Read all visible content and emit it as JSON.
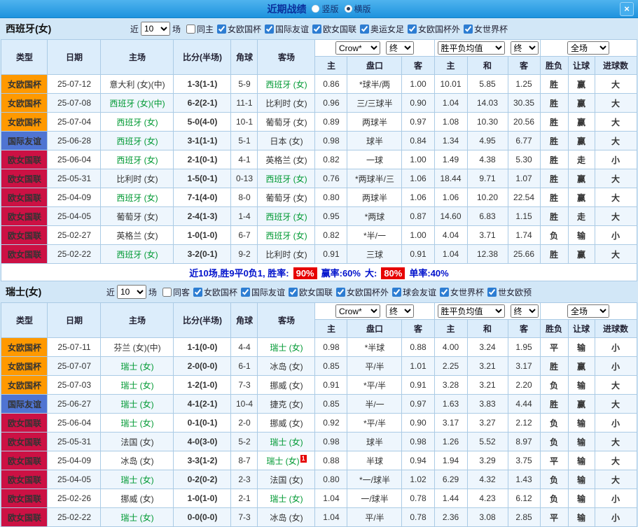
{
  "titlebar": {
    "title": "近期战绩",
    "radio_vertical": "竖版",
    "radio_horizontal": "横版",
    "close": "×"
  },
  "select_names": [
    "bookmaker-select",
    "handicap-final-select",
    "avg-type-select",
    "avg-final-select",
    "scope-select"
  ],
  "result_green": [
    "负",
    "输",
    "小"
  ],
  "colors": {
    "type_badge": {
      "女欧国杯": "#ff9900",
      "国际友谊": "#4f74d2",
      "欧女国联": "#cc1144"
    },
    "focus_team": "#009933",
    "opponent_team": "#993333",
    "score": "#dd2200",
    "odds": "#cc2200",
    "result_win": "#e60000",
    "result_lose": "#009900",
    "rate_chip_bg": "#e60000",
    "summary_text": "#0011cc"
  },
  "sections": [
    {
      "team_title": "西班牙(女)",
      "filter": {
        "near_label": "近",
        "near_value": "10",
        "games_label": "场",
        "checkboxes": [
          {
            "label": "同主",
            "checked": false
          },
          {
            "label": "女欧国杯",
            "checked": true
          },
          {
            "label": "国际友谊",
            "checked": true
          },
          {
            "label": "欧女国联",
            "checked": true
          },
          {
            "label": "奥运女足",
            "checked": true
          },
          {
            "label": "女欧国杯外",
            "checked": true
          },
          {
            "label": "女世界杯",
            "checked": true
          }
        ]
      },
      "dropdowns": [
        "Crow*",
        "终",
        "胜平负均值",
        "终",
        "全场"
      ],
      "columns": {
        "left": [
          "类型",
          "日期",
          "主场",
          "比分(半场)",
          "角球",
          "客场"
        ],
        "right": [
          "主",
          "盘口",
          "客",
          "主",
          "和",
          "客",
          "胜负",
          "让球",
          "进球数"
        ]
      },
      "rows": [
        {
          "type": "女欧国杯",
          "date": "25-07-12",
          "home": "意大利 (女)(中)",
          "home_focus": false,
          "score": "1-3(1-1)",
          "corner": "5-9",
          "away": "西班牙 (女)",
          "away_focus": true,
          "odds": [
            "0.86",
            "*球半/两",
            "1.00"
          ],
          "avg": [
            "10.01",
            "5.85",
            "1.25"
          ],
          "results": [
            "胜",
            "赢",
            "大"
          ]
        },
        {
          "type": "女欧国杯",
          "date": "25-07-08",
          "home": "西班牙 (女)(中)",
          "home_focus": true,
          "score": "6-2(2-1)",
          "corner": "11-1",
          "away": "比利时 (女)",
          "away_focus": false,
          "odds": [
            "0.96",
            "三/三球半",
            "0.90"
          ],
          "avg": [
            "1.04",
            "14.03",
            "30.35"
          ],
          "results": [
            "胜",
            "赢",
            "大"
          ]
        },
        {
          "type": "女欧国杯",
          "date": "25-07-04",
          "home": "西班牙 (女)",
          "home_focus": true,
          "score": "5-0(4-0)",
          "corner": "10-1",
          "away": "葡萄牙 (女)",
          "away_focus": false,
          "odds": [
            "0.89",
            "两球半",
            "0.97"
          ],
          "avg": [
            "1.08",
            "10.30",
            "20.56"
          ],
          "results": [
            "胜",
            "赢",
            "大"
          ]
        },
        {
          "type": "国际友谊",
          "date": "25-06-28",
          "home": "西班牙 (女)",
          "home_focus": true,
          "score": "3-1(1-1)",
          "corner": "5-1",
          "away": "日本 (女)",
          "away_focus": false,
          "odds": [
            "0.98",
            "球半",
            "0.84"
          ],
          "avg": [
            "1.34",
            "4.95",
            "6.77"
          ],
          "results": [
            "胜",
            "赢",
            "大"
          ]
        },
        {
          "type": "欧女国联",
          "date": "25-06-04",
          "home": "西班牙 (女)",
          "home_focus": true,
          "score": "2-1(0-1)",
          "corner": "4-1",
          "away": "英格兰 (女)",
          "away_focus": false,
          "odds": [
            "0.82",
            "一球",
            "1.00"
          ],
          "avg": [
            "1.49",
            "4.38",
            "5.30"
          ],
          "results": [
            "胜",
            "走",
            "小"
          ]
        },
        {
          "type": "欧女国联",
          "date": "25-05-31",
          "home": "比利时 (女)",
          "home_focus": false,
          "score": "1-5(0-1)",
          "corner": "0-13",
          "away": "西班牙 (女)",
          "away_focus": true,
          "odds": [
            "0.76",
            "*两球半/三",
            "1.06"
          ],
          "avg": [
            "18.44",
            "9.71",
            "1.07"
          ],
          "results": [
            "胜",
            "赢",
            "大"
          ]
        },
        {
          "type": "欧女国联",
          "date": "25-04-09",
          "home": "西班牙 (女)",
          "home_focus": true,
          "score": "7-1(4-0)",
          "corner": "8-0",
          "away": "葡萄牙 (女)",
          "away_focus": false,
          "odds": [
            "0.80",
            "两球半",
            "1.06"
          ],
          "avg": [
            "1.06",
            "10.20",
            "22.54"
          ],
          "results": [
            "胜",
            "赢",
            "大"
          ]
        },
        {
          "type": "欧女国联",
          "date": "25-04-05",
          "home": "葡萄牙 (女)",
          "home_focus": false,
          "score": "2-4(1-3)",
          "corner": "1-4",
          "away": "西班牙 (女)",
          "away_focus": true,
          "odds": [
            "0.95",
            "*两球",
            "0.87"
          ],
          "avg": [
            "14.60",
            "6.83",
            "1.15"
          ],
          "results": [
            "胜",
            "走",
            "大"
          ]
        },
        {
          "type": "欧女国联",
          "date": "25-02-27",
          "home": "英格兰 (女)",
          "home_focus": false,
          "score": "1-0(1-0)",
          "corner": "6-7",
          "away": "西班牙 (女)",
          "away_focus": true,
          "odds": [
            "0.82",
            "*半/一",
            "1.00"
          ],
          "avg": [
            "4.04",
            "3.71",
            "1.74"
          ],
          "results": [
            "负",
            "输",
            "小"
          ]
        },
        {
          "type": "欧女国联",
          "date": "25-02-22",
          "home": "西班牙 (女)",
          "home_focus": true,
          "score": "3-2(0-1)",
          "corner": "9-2",
          "away": "比利时 (女)",
          "away_focus": false,
          "odds": [
            "0.91",
            "三球",
            "0.91"
          ],
          "avg": [
            "1.04",
            "12.38",
            "25.66"
          ],
          "results": [
            "胜",
            "赢",
            "大"
          ]
        }
      ],
      "summary": {
        "parts": [
          {
            "text": "近10场,胜9平0负1, 胜率:",
            "chip": false
          },
          {
            "text": "90%",
            "chip": true
          },
          {
            "text": "赢率:60%",
            "chip": false
          },
          {
            "text": "大:",
            "chip": false
          },
          {
            "text": "80%",
            "chip": true
          },
          {
            "text": "单率:40%",
            "chip": false
          }
        ]
      }
    },
    {
      "team_title": "瑞士(女)",
      "filter": {
        "near_label": "近",
        "near_value": "10",
        "games_label": "场",
        "checkboxes": [
          {
            "label": "同客",
            "checked": false
          },
          {
            "label": "女欧国杯",
            "checked": true
          },
          {
            "label": "国际友谊",
            "checked": true
          },
          {
            "label": "欧女国联",
            "checked": true
          },
          {
            "label": "女欧国杯外",
            "checked": true
          },
          {
            "label": "球会友谊",
            "checked": true
          },
          {
            "label": "女世界杯",
            "checked": true
          },
          {
            "label": "世女欧预",
            "checked": true
          }
        ]
      },
      "dropdowns": [
        "Crow*",
        "终",
        "胜平负均值",
        "终",
        "全场"
      ],
      "columns": {
        "left": [
          "类型",
          "日期",
          "主场",
          "比分(半场)",
          "角球",
          "客场"
        ],
        "right": [
          "主",
          "盘口",
          "客",
          "主",
          "和",
          "客",
          "胜负",
          "让球",
          "进球数"
        ]
      },
      "rows": [
        {
          "type": "女欧国杯",
          "date": "25-07-11",
          "home": "芬兰 (女)(中)",
          "home_focus": false,
          "score": "1-1(0-0)",
          "corner": "4-4",
          "away": "瑞士 (女)",
          "away_focus": true,
          "odds": [
            "0.98",
            "*半球",
            "0.88"
          ],
          "avg": [
            "4.00",
            "3.24",
            "1.95"
          ],
          "results": [
            "平",
            "输",
            "小"
          ]
        },
        {
          "type": "女欧国杯",
          "date": "25-07-07",
          "home": "瑞士 (女)",
          "home_focus": true,
          "score": "2-0(0-0)",
          "corner": "6-1",
          "away": "冰岛 (女)",
          "away_focus": false,
          "odds": [
            "0.85",
            "平/半",
            "1.01"
          ],
          "avg": [
            "2.25",
            "3.21",
            "3.17"
          ],
          "results": [
            "胜",
            "赢",
            "小"
          ]
        },
        {
          "type": "女欧国杯",
          "date": "25-07-03",
          "home": "瑞士 (女)",
          "home_focus": true,
          "score": "1-2(1-0)",
          "corner": "7-3",
          "away": "挪威 (女)",
          "away_focus": false,
          "odds": [
            "0.91",
            "*平/半",
            "0.91"
          ],
          "avg": [
            "3.28",
            "3.21",
            "2.20"
          ],
          "results": [
            "负",
            "输",
            "大"
          ]
        },
        {
          "type": "国际友谊",
          "date": "25-06-27",
          "home": "瑞士 (女)",
          "home_focus": true,
          "score": "4-1(2-1)",
          "corner": "10-4",
          "away": "捷克 (女)",
          "away_focus": false,
          "odds": [
            "0.85",
            "半/一",
            "0.97"
          ],
          "avg": [
            "1.63",
            "3.83",
            "4.44"
          ],
          "results": [
            "胜",
            "赢",
            "大"
          ]
        },
        {
          "type": "欧女国联",
          "date": "25-06-04",
          "home": "瑞士 (女)",
          "home_focus": true,
          "score": "0-1(0-1)",
          "corner": "2-0",
          "away": "挪威 (女)",
          "away_focus": false,
          "odds": [
            "0.92",
            "*平/半",
            "0.90"
          ],
          "avg": [
            "3.17",
            "3.27",
            "2.12"
          ],
          "results": [
            "负",
            "输",
            "小"
          ]
        },
        {
          "type": "欧女国联",
          "date": "25-05-31",
          "home": "法国 (女)",
          "home_focus": false,
          "score": "4-0(3-0)",
          "corner": "5-2",
          "away": "瑞士 (女)",
          "away_focus": true,
          "odds": [
            "0.98",
            "球半",
            "0.98"
          ],
          "avg": [
            "1.26",
            "5.52",
            "8.97"
          ],
          "results": [
            "负",
            "输",
            "大"
          ]
        },
        {
          "type": "欧女国联",
          "date": "25-04-09",
          "home": "冰岛 (女)",
          "home_focus": false,
          "score": "3-3(1-2)",
          "corner": "8-7",
          "away": "瑞士 (女)",
          "away_focus": true,
          "away_card": "1",
          "odds": [
            "0.88",
            "半球",
            "0.94"
          ],
          "avg": [
            "1.94",
            "3.29",
            "3.75"
          ],
          "results": [
            "平",
            "输",
            "大"
          ]
        },
        {
          "type": "欧女国联",
          "date": "25-04-05",
          "home": "瑞士 (女)",
          "home_focus": true,
          "score": "0-2(0-2)",
          "corner": "2-3",
          "away": "法国 (女)",
          "away_focus": false,
          "odds": [
            "0.80",
            "*一/球半",
            "1.02"
          ],
          "avg": [
            "6.29",
            "4.32",
            "1.43"
          ],
          "results": [
            "负",
            "输",
            "大"
          ]
        },
        {
          "type": "欧女国联",
          "date": "25-02-26",
          "home": "挪威 (女)",
          "home_focus": false,
          "score": "1-0(1-0)",
          "corner": "2-1",
          "away": "瑞士 (女)",
          "away_focus": true,
          "odds": [
            "1.04",
            "一/球半",
            "0.78"
          ],
          "avg": [
            "1.44",
            "4.23",
            "6.12"
          ],
          "results": [
            "负",
            "输",
            "小"
          ]
        },
        {
          "type": "欧女国联",
          "date": "25-02-22",
          "home": "瑞士 (女)",
          "home_focus": true,
          "score": "0-0(0-0)",
          "corner": "7-3",
          "away": "冰岛 (女)",
          "away_focus": false,
          "odds": [
            "1.04",
            "平/半",
            "0.78"
          ],
          "avg": [
            "2.36",
            "3.08",
            "2.85"
          ],
          "results": [
            "平",
            "输",
            "小"
          ]
        }
      ],
      "summary": null
    }
  ]
}
